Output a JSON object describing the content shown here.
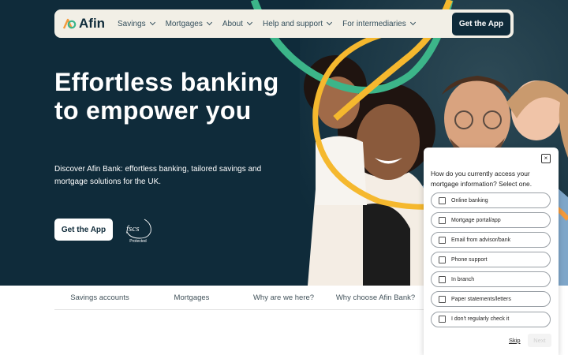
{
  "nav": {
    "logo_text": "Afin",
    "items": [
      {
        "label": "Savings"
      },
      {
        "label": "Mortgages"
      },
      {
        "label": "About"
      },
      {
        "label": "Help and support"
      },
      {
        "label": "For intermediaries"
      }
    ],
    "cta_label": "Get the App"
  },
  "hero": {
    "title": "Effortless banking to empower you",
    "subtitle": "Discover Afin Bank: effortless banking, tailored savings and mortgage solutions for the UK.",
    "cta_label": "Get the App",
    "badge_text": "fscs",
    "badge_caption": "Protected"
  },
  "subnav": {
    "items": [
      {
        "label": "Savings accounts"
      },
      {
        "label": "Mortgages"
      },
      {
        "label": "Why are we here?"
      },
      {
        "label": "Why choose Afin Bank?"
      }
    ]
  },
  "survey": {
    "close_label": "×",
    "question": "How do you currently access your mortgage information? Select one.",
    "options": [
      {
        "label": "Online banking"
      },
      {
        "label": "Mortgage portal/app"
      },
      {
        "label": "Email from advisor/bank"
      },
      {
        "label": "Phone support"
      },
      {
        "label": "In branch"
      },
      {
        "label": "Paper statements/letters"
      },
      {
        "label": "I don't regularly check it"
      }
    ],
    "skip_label": "Skip",
    "next_label": "Next"
  },
  "colors": {
    "hero_bg": "#0f2b3a",
    "nav_bg": "#f2efe6",
    "accent_green": "#3cb589",
    "accent_yellow": "#f5b82e",
    "accent_orange": "#f39a3b"
  }
}
